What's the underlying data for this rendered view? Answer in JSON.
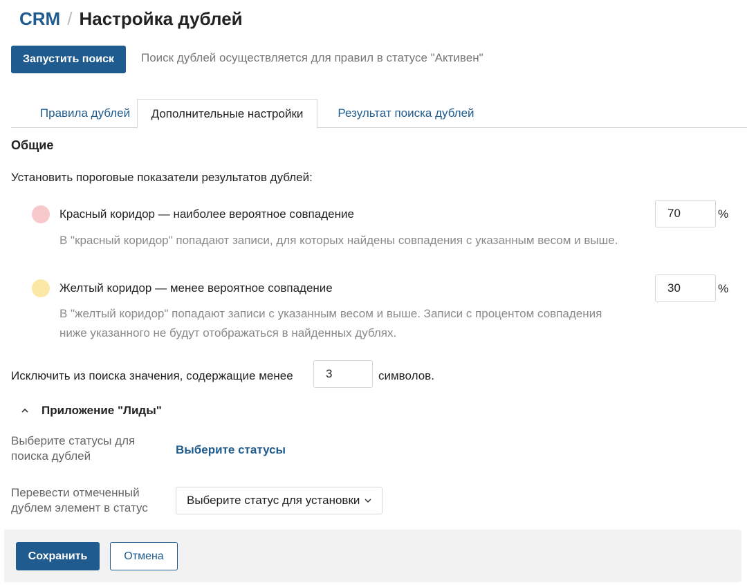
{
  "header": {
    "app": "CRM",
    "separator": "/",
    "title": "Настройка дублей"
  },
  "toolbar": {
    "run_search_label": "Запустить поиск",
    "hint": "Поиск дублей осуществляется для правил в статусе \"Активен\""
  },
  "tabs": [
    {
      "label": "Правила дублей",
      "active": false
    },
    {
      "label": "Дополнительные настройки",
      "active": true
    },
    {
      "label": "Результат поиска дублей",
      "active": false
    }
  ],
  "general": {
    "title": "Общие",
    "threshold_label": "Установить пороговые показатели результатов дублей:",
    "red": {
      "title": "Красный коридор — наиболее вероятное совпадение",
      "description": "В \"красный коридор\" попадают записи, для которых найдены совпадения с указанным весом и выше.",
      "value": "70",
      "unit": "%",
      "color": "#f7c9cc"
    },
    "yellow": {
      "title": "Желтый коридор — менее вероятное совпадение",
      "description": "В \"желтый коридор\" попадают записи с указанным весом и выше. Записи с процентом совпадения ниже указанного не будут отображаться в найденных дублях.",
      "value": "30",
      "unit": "%",
      "color": "#fbe7a6"
    },
    "exclude": {
      "prefix": "Исключить из поиска значения, содержащие менее",
      "value": "3",
      "suffix": "символов."
    }
  },
  "leads": {
    "title": "Приложение \"Лиды\"",
    "icon": "chevron-up-icon",
    "statuses_label": "Выберите статусы для поиска дублей",
    "statuses_link": "Выберите статусы",
    "move_label": "Перевести отмеченный дублем элемент в статус",
    "move_select": "Выберите статус для установки"
  },
  "footer": {
    "save_label": "Сохранить",
    "cancel_label": "Отмена"
  },
  "colors": {
    "accent": "#1f5b8e"
  }
}
